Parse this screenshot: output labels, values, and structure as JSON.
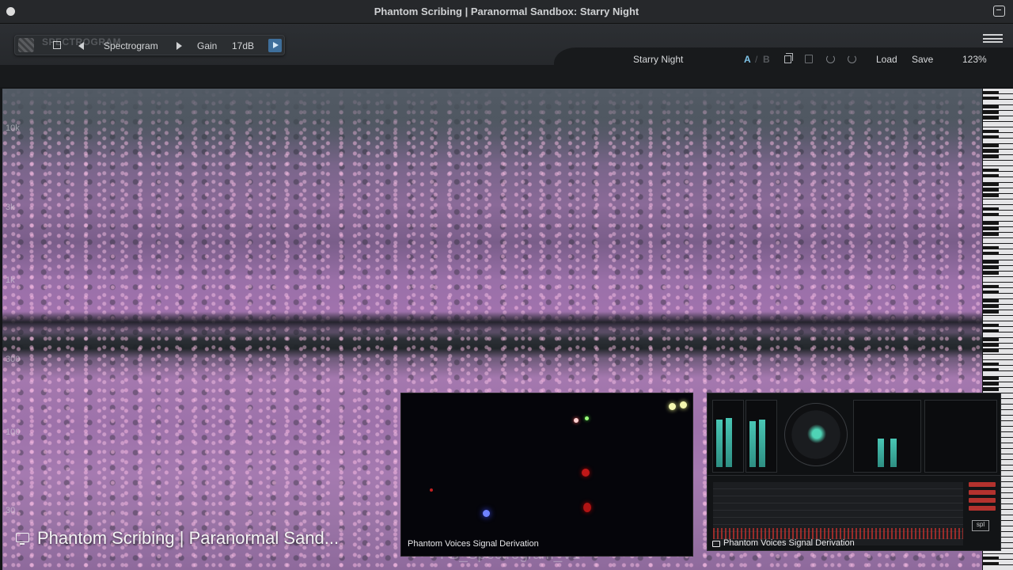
{
  "window": {
    "title": "Phantom Scribing | Paranormal Sandbox: Starry Night"
  },
  "toolbar": {
    "logo_text": "SPECTROGRAM",
    "view_label": "Spectrogram",
    "gain_label": "Gain",
    "gain_value": "17dB"
  },
  "preset_bar": {
    "preset_name": "Starry Night",
    "ab_a": "A",
    "ab_sep": "/",
    "ab_b": "B",
    "load_label": "Load",
    "save_label": "Save",
    "zoom": "123%"
  },
  "spectrogram": {
    "freq_labels": [
      "10k",
      "3k",
      "1k",
      "300",
      "100",
      "30"
    ]
  },
  "overlays": {
    "screen_caption": "Phantom Scribing | Paranormal Sand...",
    "ghost_window_text": "FB_Spectrogram_V1",
    "camera_caption": "Phantom Voices Signal Derivation",
    "meter_caption": "Phantom Voices Signal Derivation",
    "meter_logo": "spl"
  },
  "colors": {
    "accent_blue": "#3e6f9b",
    "ab_active": "#7fc4e8",
    "spectrogram_pink": "#a072ad",
    "meter_teal": "#49c6b4",
    "meter_red": "#b8302c"
  }
}
